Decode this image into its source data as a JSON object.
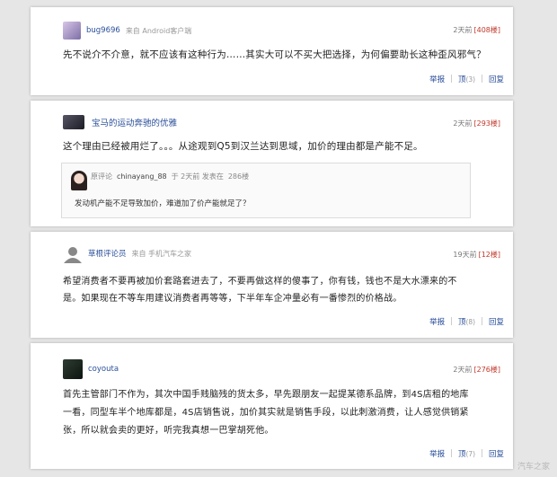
{
  "comments": [
    {
      "username": "bug9696",
      "source": "来自 Android客户端",
      "time": "2天前",
      "floor": "[408楼]",
      "text": "先不说介不介意，就不应该有这种行为……其实大可以不买大把选择，为何偏要助长这种歪风邪气？",
      "report": "举报",
      "like": "顶",
      "like_count": "(3)",
      "reply": "回复"
    },
    {
      "username": "宝马的运动奔驰的优雅",
      "time": "2天前",
      "floor": "[293楼]",
      "text": "这个理由已经被用烂了。。。从途观到Q5到汉兰达到思域，加价的理由都是产能不足。",
      "quote": {
        "label": "原评论",
        "username": "chinayang_88",
        "at": "于 2天前 发表在",
        "floor": "286楼",
        "text": "发动机产能不足导致加价，难道加了价产能就足了？"
      }
    },
    {
      "username": "草根评论员",
      "source": "来自 手机汽车之家",
      "time": "19天前",
      "floor": "[12楼]",
      "text_lines": [
        "希望消费者不要再被加价套路套进去了，不要再做这样的傻事了，你有钱，钱也不是大水漂来的不",
        "是。如果现在不等车用建议消费者再等等，下半年车企冲量必有一番惨烈的价格战。"
      ],
      "report": "举报",
      "like": "顶",
      "like_count": "(8)",
      "reply": "回复"
    },
    {
      "username": "coyouta",
      "time": "2天前",
      "floor": "[276楼]",
      "text_lines": [
        "首先主管部门不作为，其次中国手贱脑残的货太多，早先跟朋友一起提某德系品牌，到4S店租的地库",
        "一看，同型车半个地库都是，4S店销售说，加价其实就是销售手段，以此刺激消费，让人感觉供销紧",
        "张，所以就会卖的更好，听完我真想一巴掌胡死他。"
      ],
      "report": "举报",
      "like": "顶",
      "like_count": "(7)",
      "reply": "回复"
    }
  ],
  "watermark": "汽车之家",
  "colors": {
    "link": "#2a4f9a",
    "floor": "#c0392b",
    "bg": "#e6e6e6"
  }
}
